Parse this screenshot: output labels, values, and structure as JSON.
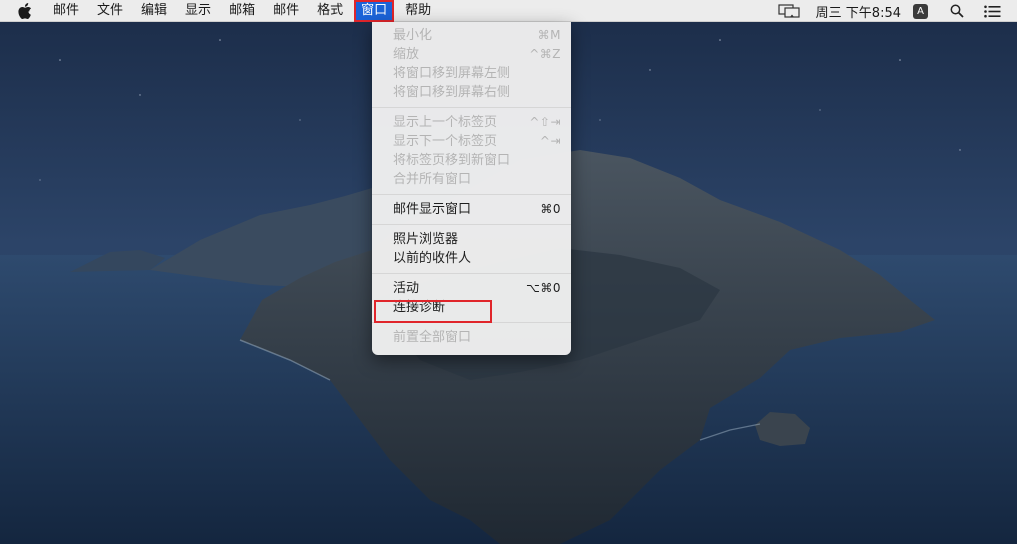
{
  "menubar": {
    "apple_icon": "apple-logo-icon",
    "items": [
      {
        "label": "邮件"
      },
      {
        "label": "文件"
      },
      {
        "label": "编辑"
      },
      {
        "label": "显示"
      },
      {
        "label": "邮箱"
      },
      {
        "label": "邮件"
      },
      {
        "label": "格式"
      },
      {
        "label": "窗口",
        "active": true
      },
      {
        "label": "帮助"
      }
    ],
    "status": {
      "display_icon": "airplay-display-icon",
      "clock": "周三 下午8:54",
      "input_source": "A",
      "search_icon": "spotlight-search-icon",
      "notification_icon": "notification-center-icon"
    }
  },
  "window_menu": {
    "groups": [
      [
        {
          "label": "最小化",
          "shortcut": "⌘M",
          "enabled": false
        },
        {
          "label": "缩放",
          "shortcut": "^⌘Z",
          "enabled": false
        },
        {
          "label": "将窗口移到屏幕左侧",
          "shortcut": "",
          "enabled": false
        },
        {
          "label": "将窗口移到屏幕右侧",
          "shortcut": "",
          "enabled": false
        }
      ],
      [
        {
          "label": "显示上一个标签页",
          "shortcut": "^⇧⇥",
          "enabled": false
        },
        {
          "label": "显示下一个标签页",
          "shortcut": "^⇥",
          "enabled": false
        },
        {
          "label": "将标签页移到新窗口",
          "shortcut": "",
          "enabled": false
        },
        {
          "label": "合并所有窗口",
          "shortcut": "",
          "enabled": false
        }
      ],
      [
        {
          "label": "邮件显示窗口",
          "shortcut": "⌘0",
          "enabled": true
        }
      ],
      [
        {
          "label": "照片浏览器",
          "shortcut": "",
          "enabled": true
        },
        {
          "label": "以前的收件人",
          "shortcut": "",
          "enabled": true
        }
      ],
      [
        {
          "label": "活动",
          "shortcut": "⌥⌘0",
          "enabled": true
        },
        {
          "label": "连接诊断",
          "shortcut": "",
          "enabled": true,
          "highlighted": true
        }
      ],
      [
        {
          "label": "前置全部窗口",
          "shortcut": "",
          "enabled": false
        }
      ]
    ]
  },
  "colors": {
    "menu_active": "#1c63d8",
    "annotation_red": "#e0252b",
    "disabled_text": "#b4b4b4"
  }
}
